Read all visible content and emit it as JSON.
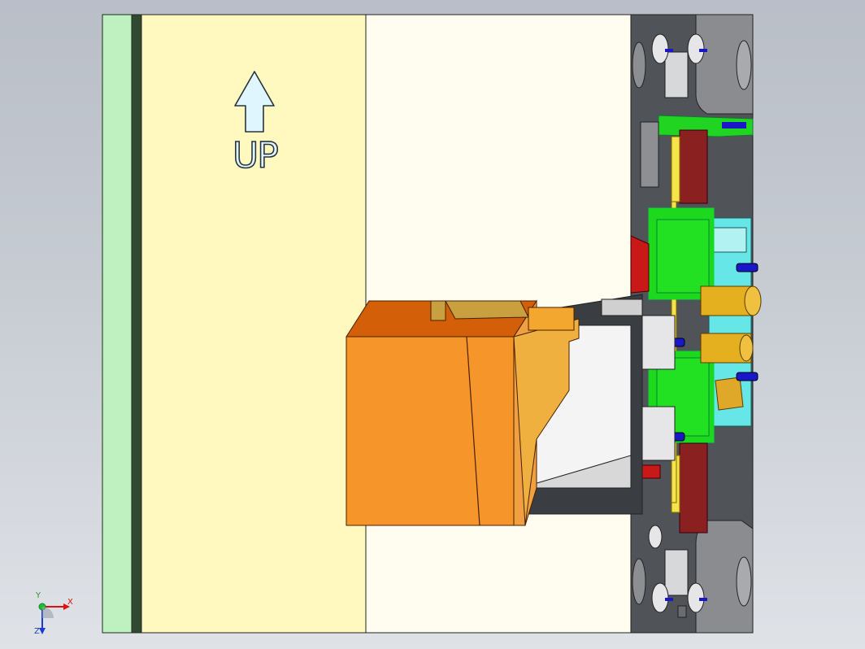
{
  "viewport": {
    "up_label": "UP",
    "arrow_icon": "up-arrow-icon"
  },
  "triad": {
    "x_label": "X",
    "y_label": "Y",
    "z_label": "Z"
  },
  "colors": {
    "background_top": "#b9bec7",
    "mint_plate": "#bff0c0",
    "dark_green_strip": "#2f4a30",
    "yellow_plate": "#fff9bf",
    "ivory_plate": "#fffdf0",
    "dark_plate": "#505358",
    "orange_slide": "#f5952a",
    "green_block": "#1ed81e",
    "cyan_plate": "#66e6e6",
    "gold_pin": "#e4b020",
    "red_part": "#c81818",
    "blue_screw": "#1818c8"
  }
}
